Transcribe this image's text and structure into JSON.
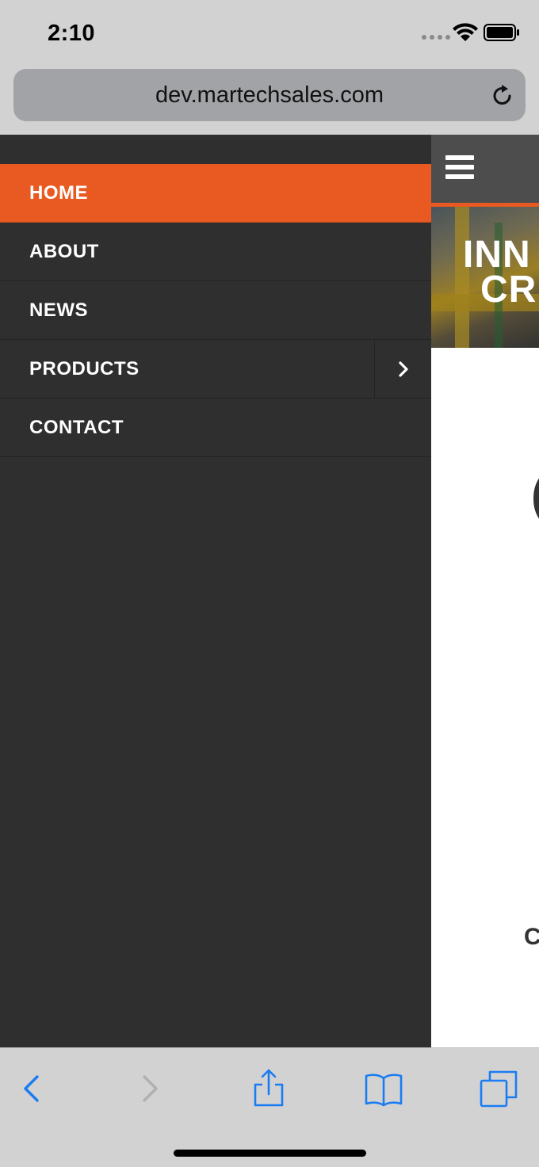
{
  "status_bar": {
    "time": "2:10"
  },
  "browser": {
    "url": "dev.martechsales.com"
  },
  "menu": {
    "items": [
      {
        "label": "HOME"
      },
      {
        "label": "ABOUT"
      },
      {
        "label": "NEWS"
      },
      {
        "label": "PRODUCTS"
      },
      {
        "label": "CONTACT"
      }
    ]
  },
  "hero": {
    "line1": "INN",
    "line2": "CR"
  },
  "peek": {
    "glyph": "(",
    "letter": "C"
  },
  "colors": {
    "accent": "#e85a22",
    "menu_bg": "#2f2f2f",
    "header_bg": "#4d4d4d",
    "ios_blue": "#1a7cf2"
  }
}
